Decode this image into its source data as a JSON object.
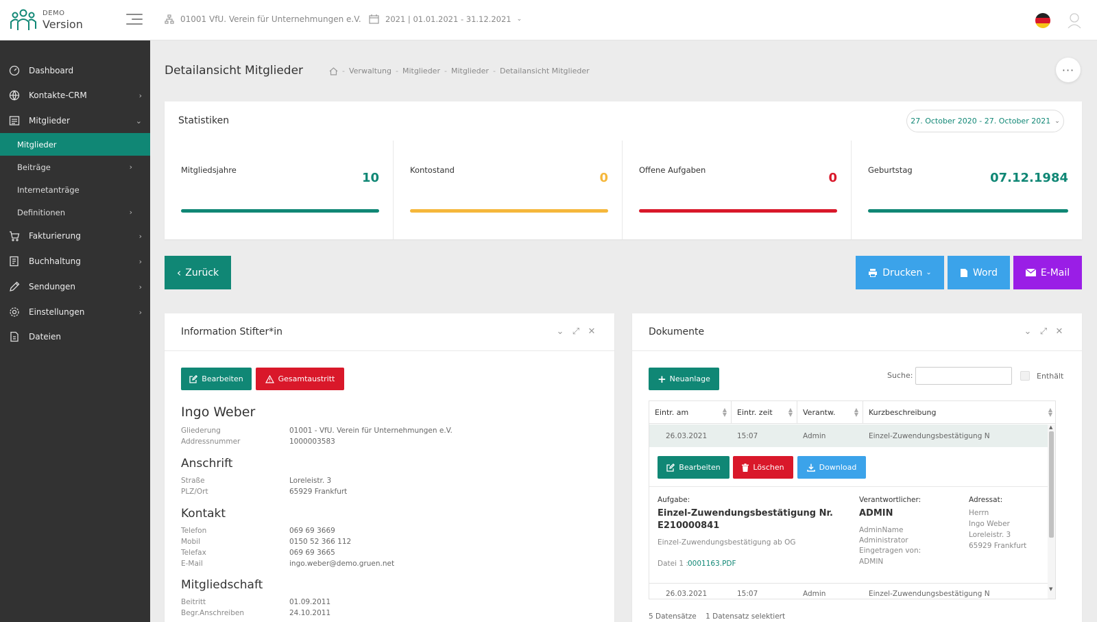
{
  "brand": {
    "small": "DEMO",
    "big": "Version"
  },
  "topbar": {
    "organization": "01001 VfU. Verein für Unternehmungen e.V.",
    "period": "2021 | 01.01.2021 - 31.12.2021"
  },
  "sidebar": {
    "items": [
      {
        "label": "Dashboard",
        "icon": "dashboard-icon"
      },
      {
        "label": "Kontakte-CRM",
        "icon": "globe-icon"
      },
      {
        "label": "Mitglieder",
        "icon": "members-icon"
      },
      {
        "label": "Fakturierung",
        "icon": "cart-icon"
      },
      {
        "label": "Buchhaltung",
        "icon": "book-icon"
      },
      {
        "label": "Sendungen",
        "icon": "pencil-icon"
      },
      {
        "label": "Einstellungen",
        "icon": "gear-icon"
      },
      {
        "label": "Dateien",
        "icon": "file-icon"
      }
    ],
    "sub_items": [
      {
        "label": "Mitglieder"
      },
      {
        "label": "Beiträge"
      },
      {
        "label": "Internetanträge"
      },
      {
        "label": "Definitionen"
      }
    ]
  },
  "page": {
    "title": "Detailansicht Mitglieder",
    "breadcrumb": [
      "Verwaltung",
      "Mitglieder",
      "Mitglieder",
      "Detailansicht Mitglieder"
    ],
    "more": "···"
  },
  "stats": {
    "title": "Statistiken",
    "date_range": "27. October 2020 - 27. October 2021",
    "cards": [
      {
        "label": "Mitgliedsjahre",
        "value": "10",
        "color": "#108775"
      },
      {
        "label": "Kontostand",
        "value": "0",
        "color": "#f5b73b"
      },
      {
        "label": "Offene Aufgaben",
        "value": "0",
        "color": "#d9182a"
      },
      {
        "label": "Geburtstag",
        "value": "07.12.1984",
        "color": "#108775"
      }
    ]
  },
  "actions": {
    "back": "Zurück",
    "print": "Drucken",
    "word": "Word",
    "email": "E-Mail"
  },
  "info": {
    "title": "Information Stifter*in",
    "edit": "Bearbeiten",
    "exit": "Gesamtaustritt",
    "name": "Ingo Weber",
    "general": [
      {
        "label": "Gliederung",
        "value": "01001 - VfU. Verein für Unternehmungen e.V."
      },
      {
        "label": "Addressnummer",
        "value": "1000003583"
      }
    ],
    "address_title": "Anschrift",
    "address": [
      {
        "label": "Straße",
        "value": "Loreleistr. 3"
      },
      {
        "label": "PLZ/Ort",
        "value": "65929 Frankfurt"
      }
    ],
    "contact_title": "Kontakt",
    "contact": [
      {
        "label": "Telefon",
        "value": "069 69 3669"
      },
      {
        "label": "Mobil",
        "value": "0150 52 366 112"
      },
      {
        "label": "Telefax",
        "value": "069 69 3665"
      },
      {
        "label": "E-Mail",
        "value": "ingo.weber@demo.gruen.net"
      }
    ],
    "membership_title": "Mitgliedschaft",
    "membership": [
      {
        "label": "Beitritt",
        "value": "01.09.2011"
      },
      {
        "label": "Begr.Anschreiben",
        "value": "24.10.2011"
      }
    ]
  },
  "docs": {
    "title": "Dokumente",
    "new": "Neuanlage",
    "search_label": "Suche:",
    "search_value": "",
    "contains": "Enthält",
    "columns": [
      "Eintr. am",
      "Eintr. zeit",
      "Verantw.",
      "Kurzbeschreibung"
    ],
    "rows": [
      {
        "date": "26.03.2021",
        "time": "15:07",
        "resp": "Admin",
        "desc": "Einzel-Zuwendungsbestätigung N"
      },
      {
        "date": "26.03.2021",
        "time": "15:07",
        "resp": "Admin",
        "desc": "Einzel-Zuwendungsbestätigung N"
      }
    ],
    "row_actions": {
      "edit": "Bearbeiten",
      "delete": "Löschen",
      "download": "Download"
    },
    "detail": {
      "task_label": "Aufgabe:",
      "task_title_1": "Einzel-Zuwendungsbestätigung Nr.",
      "task_title_2": "E210000841",
      "task_sub": "Einzel-Zuwendungsbestätigung ab OG",
      "file_label": "Datei 1 :",
      "file_link": "0001163.PDF",
      "resp_label": "Verantwortlicher:",
      "resp_name": "ADMIN",
      "resp_lines": [
        "AdminName",
        "Administrator",
        "Eingetragen von:",
        "ADMIN"
      ],
      "addr_label": "Adressat:",
      "addr_lines": [
        "Herrn",
        "Ingo Weber",
        "Loreleistr. 3",
        "65929 Frankfurt"
      ]
    },
    "footer_count": "5 Datensätze",
    "footer_selected": "1 Datensatz selektiert"
  },
  "colors": {
    "primary": "#108775",
    "danger": "#d9182a",
    "info": "#3ba3ea",
    "purple": "#9a1ee6",
    "sidebar": "#323232"
  }
}
